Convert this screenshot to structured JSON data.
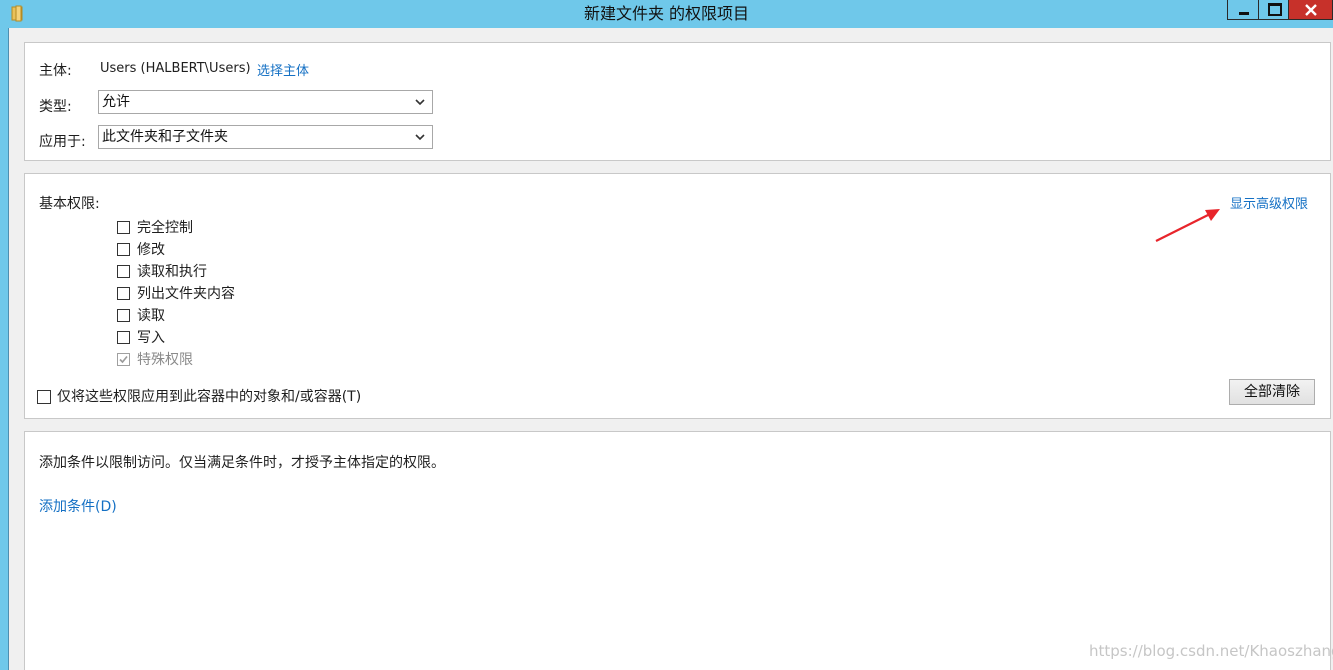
{
  "window": {
    "title": "新建文件夹 的权限项目"
  },
  "principal_section": {
    "principal_label": "主体:",
    "principal_value": "Users (HALBERT\\Users)",
    "select_principal_link": "选择主体",
    "type_label": "类型:",
    "type_value": "允许",
    "applies_to_label": "应用于:",
    "applies_to_value": "此文件夹和子文件夹"
  },
  "permissions_section": {
    "basic_label": "基本权限:",
    "show_advanced_link": "显示高级权限",
    "permissions": [
      {
        "label": "完全控制",
        "checked": false,
        "disabled": false
      },
      {
        "label": "修改",
        "checked": false,
        "disabled": false
      },
      {
        "label": "读取和执行",
        "checked": false,
        "disabled": false
      },
      {
        "label": "列出文件夹内容",
        "checked": false,
        "disabled": false
      },
      {
        "label": "读取",
        "checked": false,
        "disabled": false
      },
      {
        "label": "写入",
        "checked": false,
        "disabled": false
      },
      {
        "label": "特殊权限",
        "checked": true,
        "disabled": true
      }
    ],
    "apply_only_label": "仅将这些权限应用到此容器中的对象和/或容器(T)",
    "clear_all_button": "全部清除"
  },
  "condition_section": {
    "description": "添加条件以限制访问。仅当满足条件时，才授予主体指定的权限。",
    "add_condition_link": "添加条件(D)"
  },
  "watermark": "https://blog.csdn.net/Khaoszhang",
  "colors": {
    "titlebar": "#6fc8ea",
    "link": "#1470c4",
    "close_button": "#c7312a",
    "annotation_arrow": "#e8252b"
  }
}
